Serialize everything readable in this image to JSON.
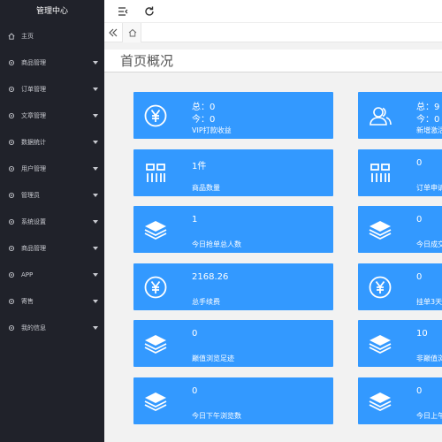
{
  "sidebar": {
    "title": "管理中心",
    "items": [
      {
        "label": "主页",
        "icon": "home-icon",
        "has_arrow": false
      },
      {
        "label": "商品管理",
        "icon": "gear-icon",
        "has_arrow": true
      },
      {
        "label": "订单管理",
        "icon": "gear-icon",
        "has_arrow": true
      },
      {
        "label": "文章管理",
        "icon": "gear-icon",
        "has_arrow": true
      },
      {
        "label": "数据统计",
        "icon": "gear-icon",
        "has_arrow": true
      },
      {
        "label": "用户管理",
        "icon": "gear-icon",
        "has_arrow": true
      },
      {
        "label": "管理员",
        "icon": "gear-icon",
        "has_arrow": true
      },
      {
        "label": "系统设置",
        "icon": "gear-icon",
        "has_arrow": true
      },
      {
        "label": "商品管理",
        "icon": "gear-icon",
        "has_arrow": true
      },
      {
        "label": "APP",
        "icon": "gear-icon",
        "has_arrow": true
      },
      {
        "label": "寄售",
        "icon": "gear-icon",
        "has_arrow": true
      },
      {
        "label": "我的信息",
        "icon": "gear-icon",
        "has_arrow": true
      }
    ]
  },
  "header": {
    "menu_icon": "menu-toggle-icon",
    "refresh_icon": "refresh-icon"
  },
  "tabs": {
    "back_icon": "double-chevron-left-icon",
    "home_icon": "home-icon"
  },
  "main": {
    "page_title": "首页概况"
  },
  "cards": [
    {
      "icon": "yen-icon",
      "line1": "总：0",
      "line2": "今：0",
      "caption": "VIP打款收益"
    },
    {
      "icon": "users-icon",
      "line1": "总：9",
      "line2": "今：0",
      "caption": "新增激活"
    },
    {
      "icon": "grid-icon",
      "line1": "1件",
      "line2": "",
      "caption": "商品数量"
    },
    {
      "icon": "grid-icon",
      "line1": "0",
      "line2": "",
      "caption": "订单申请"
    },
    {
      "icon": "layers-icon",
      "line1": "1",
      "line2": "",
      "caption": "今日抢单总人数"
    },
    {
      "icon": "layers-icon",
      "line1": "0",
      "line2": "",
      "caption": "今日成交"
    },
    {
      "icon": "yen-icon",
      "line1": "2168.26",
      "line2": "",
      "caption": "总手续费"
    },
    {
      "icon": "yen-icon",
      "line1": "0",
      "line2": "",
      "caption": "挂单3天"
    },
    {
      "icon": "layers-icon",
      "line1": "0",
      "line2": "",
      "caption": "巅值浏览足迹"
    },
    {
      "icon": "layers-icon",
      "line1": "10",
      "line2": "",
      "caption": "非巅值浏"
    },
    {
      "icon": "layers-icon",
      "line1": "0",
      "line2": "",
      "caption": "今日下午浏览数"
    },
    {
      "icon": "layers-icon",
      "line1": "0",
      "line2": "",
      "caption": "今日上午"
    }
  ],
  "colors": {
    "sidebar_bg": "#20222a",
    "card_bg": "#3399ff",
    "main_bg": "#f2f2f2"
  }
}
